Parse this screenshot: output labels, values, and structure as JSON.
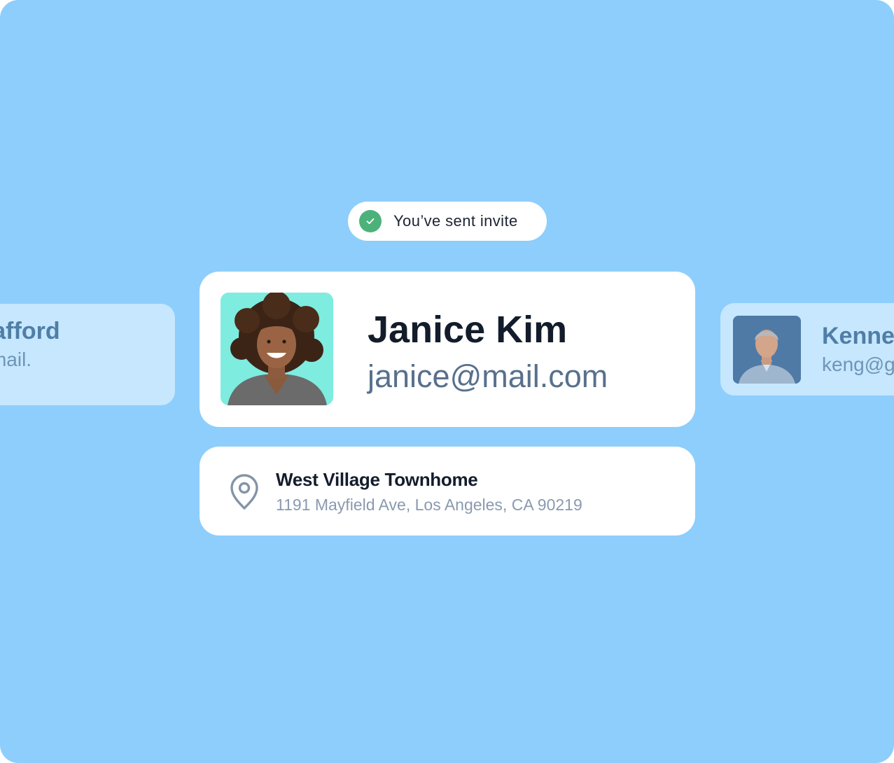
{
  "toast": {
    "text": "You’ve sent invite",
    "icon": "check-icon",
    "icon_color": "#4cb27a"
  },
  "main_contact": {
    "name": "Janice Kim",
    "email": "janice@mail.com",
    "avatar_bg": "#7eecdf"
  },
  "location": {
    "icon": "location-pin-icon",
    "title": "West Village Townhome",
    "address": "1191 Mayfield Ave, Los Angeles, CA 90219"
  },
  "left_contact": {
    "name": "ke Stafford",
    "email": "fford@mail."
  },
  "right_contact": {
    "name": "Kennet",
    "email": "keng@g"
  },
  "colors": {
    "background": "#8dcefc",
    "card": "#ffffff",
    "name_text": "#131c2b",
    "email_text": "#58708d",
    "faded_text": "#4f7ea6"
  }
}
